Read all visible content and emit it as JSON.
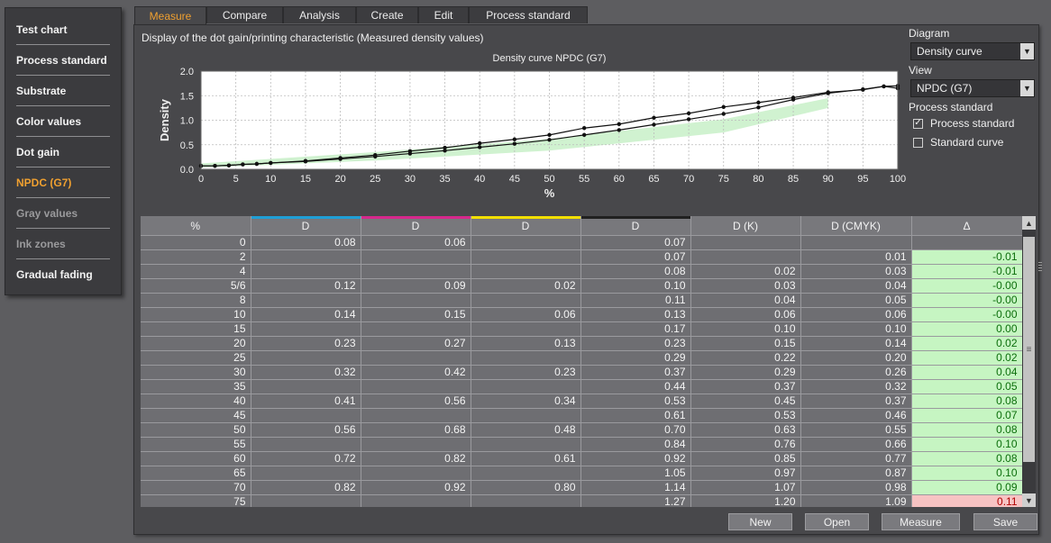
{
  "sidebar": {
    "items": [
      {
        "label": "Test chart",
        "state": "normal"
      },
      {
        "label": "Process standard",
        "state": "normal"
      },
      {
        "label": "Substrate",
        "state": "normal"
      },
      {
        "label": "Color values",
        "state": "normal"
      },
      {
        "label": "Dot gain",
        "state": "normal"
      },
      {
        "label": "NPDC (G7)",
        "state": "active"
      },
      {
        "label": "Gray values",
        "state": "dim"
      },
      {
        "label": "Ink zones",
        "state": "dim"
      },
      {
        "label": "Gradual fading",
        "state": "normal"
      }
    ]
  },
  "tabs": [
    "Measure",
    "Compare",
    "Analysis",
    "Create",
    "Edit",
    "Process standard"
  ],
  "active_tab": "Measure",
  "description": "Display of the dot gain/printing characteristic (Measured density values)",
  "controls": {
    "diagram_label": "Diagram",
    "diagram_value": "Density curve",
    "view_label": "View",
    "view_value": "NPDC (G7)",
    "process_standard_label": "Process standard",
    "checkbox_process_standard": {
      "label": "Process standard",
      "checked": true,
      "mark": "✓"
    },
    "checkbox_standard_curve": {
      "label": "Standard curve",
      "checked": false,
      "mark": ""
    }
  },
  "chart_data": {
    "type": "line",
    "title": "Density curve NPDC (G7)",
    "xlabel": "%",
    "ylabel": "Density",
    "xlim": [
      0,
      100
    ],
    "ylim": [
      0,
      2.0
    ],
    "x_ticks": [
      0,
      5,
      10,
      15,
      20,
      25,
      30,
      35,
      40,
      45,
      50,
      55,
      60,
      65,
      70,
      75,
      80,
      85,
      90,
      95,
      100
    ],
    "y_ticks": [
      0.0,
      0.5,
      1.0,
      1.5,
      2.0
    ],
    "y_tick_labels": [
      "0.0",
      "0.5",
      "1.0",
      "1.5",
      "2.0"
    ],
    "grid": true,
    "series": [
      {
        "values": [
          [
            0,
            0.07
          ],
          [
            2,
            0.07
          ],
          [
            4,
            0.08
          ],
          [
            6,
            0.1
          ],
          [
            8,
            0.11
          ],
          [
            10,
            0.13
          ],
          [
            15,
            0.17
          ],
          [
            20,
            0.23
          ],
          [
            25,
            0.29
          ],
          [
            30,
            0.37
          ],
          [
            35,
            0.44
          ],
          [
            40,
            0.53
          ],
          [
            45,
            0.61
          ],
          [
            50,
            0.7
          ],
          [
            55,
            0.84
          ],
          [
            60,
            0.92
          ],
          [
            65,
            1.05
          ],
          [
            70,
            1.14
          ],
          [
            75,
            1.27
          ],
          [
            80,
            1.36
          ],
          [
            85,
            1.46
          ],
          [
            90,
            1.57
          ],
          [
            95,
            1.62
          ],
          [
            98,
            1.69
          ],
          [
            100,
            1.7
          ]
        ]
      },
      {
        "values": [
          [
            0,
            0.07
          ],
          [
            2,
            0.07
          ],
          [
            4,
            0.08
          ],
          [
            6,
            0.1
          ],
          [
            8,
            0.11
          ],
          [
            10,
            0.13
          ],
          [
            15,
            0.16
          ],
          [
            20,
            0.21
          ],
          [
            25,
            0.26
          ],
          [
            30,
            0.32
          ],
          [
            35,
            0.38
          ],
          [
            40,
            0.45
          ],
          [
            45,
            0.52
          ],
          [
            50,
            0.6
          ],
          [
            55,
            0.7
          ],
          [
            60,
            0.8
          ],
          [
            65,
            0.91
          ],
          [
            70,
            1.02
          ],
          [
            75,
            1.13
          ],
          [
            80,
            1.26
          ],
          [
            85,
            1.42
          ],
          [
            90,
            1.55
          ],
          [
            95,
            1.63
          ],
          [
            98,
            1.69
          ],
          [
            100,
            1.65
          ]
        ]
      }
    ],
    "tolerance_band": {
      "lower": [
        [
          0,
          0.03
        ],
        [
          25,
          0.18
        ],
        [
          50,
          0.38
        ],
        [
          75,
          0.75
        ],
        [
          90,
          1.25
        ]
      ],
      "upper": [
        [
          0,
          0.12
        ],
        [
          25,
          0.35
        ],
        [
          50,
          0.62
        ],
        [
          75,
          1.02
        ],
        [
          90,
          1.45
        ]
      ],
      "color": "#c8f0c8"
    },
    "colors": {
      "series": "#111111",
      "band": "#c8f0c8",
      "background": "#ffffff",
      "grid": "#bbbbbb"
    }
  },
  "table": {
    "headers": [
      "%",
      "D",
      "D",
      "D",
      "D",
      "D (K)",
      "D (CMYK)",
      "Δ"
    ],
    "header_bar_colors": [
      "",
      "#1f9fd6",
      "#d6288c",
      "#f2e000",
      "#202020",
      "",
      "",
      ""
    ],
    "rows": [
      [
        "0",
        "0.08",
        "0.06",
        "",
        "0.07",
        "",
        "",
        ""
      ],
      [
        "2",
        "",
        "",
        "",
        "0.07",
        "",
        "0.01",
        "-0.01"
      ],
      [
        "4",
        "",
        "",
        "",
        "0.08",
        "0.02",
        "0.03",
        "-0.01"
      ],
      [
        "5/6",
        "0.12",
        "0.09",
        "0.02",
        "0.10",
        "0.03",
        "0.04",
        "-0.00"
      ],
      [
        "8",
        "",
        "",
        "",
        "0.11",
        "0.04",
        "0.05",
        "-0.00"
      ],
      [
        "10",
        "0.14",
        "0.15",
        "0.06",
        "0.13",
        "0.06",
        "0.06",
        "-0.00"
      ],
      [
        "15",
        "",
        "",
        "",
        "0.17",
        "0.10",
        "0.10",
        "0.00"
      ],
      [
        "20",
        "0.23",
        "0.27",
        "0.13",
        "0.23",
        "0.15",
        "0.14",
        "0.02"
      ],
      [
        "25",
        "",
        "",
        "",
        "0.29",
        "0.22",
        "0.20",
        "0.02"
      ],
      [
        "30",
        "0.32",
        "0.42",
        "0.23",
        "0.37",
        "0.29",
        "0.26",
        "0.04"
      ],
      [
        "35",
        "",
        "",
        "",
        "0.44",
        "0.37",
        "0.32",
        "0.05"
      ],
      [
        "40",
        "0.41",
        "0.56",
        "0.34",
        "0.53",
        "0.45",
        "0.37",
        "0.08"
      ],
      [
        "45",
        "",
        "",
        "",
        "0.61",
        "0.53",
        "0.46",
        "0.07"
      ],
      [
        "50",
        "0.56",
        "0.68",
        "0.48",
        "0.70",
        "0.63",
        "0.55",
        "0.08"
      ],
      [
        "55",
        "",
        "",
        "",
        "0.84",
        "0.76",
        "0.66",
        "0.10"
      ],
      [
        "60",
        "0.72",
        "0.82",
        "0.61",
        "0.92",
        "0.85",
        "0.77",
        "0.08"
      ],
      [
        "65",
        "",
        "",
        "",
        "1.05",
        "0.97",
        "0.87",
        "0.10"
      ],
      [
        "70",
        "0.82",
        "0.92",
        "0.80",
        "1.14",
        "1.07",
        "0.98",
        "0.09"
      ],
      [
        "75",
        "",
        "",
        "",
        "1.27",
        "1.20",
        "1.09",
        "0.11"
      ]
    ],
    "delta_status": [
      "none",
      "ok",
      "ok",
      "ok",
      "ok",
      "ok",
      "ok",
      "ok",
      "ok",
      "ok",
      "ok",
      "ok",
      "ok",
      "ok",
      "ok",
      "ok",
      "ok",
      "ok",
      "bad"
    ],
    "status_colors": {
      "ok": "#c6f5c2",
      "bad": "#f7c3c3"
    }
  },
  "scrollbar": {
    "up_icon": "▲",
    "down_icon": "▼",
    "grip_icon": "≡"
  },
  "buttons": {
    "new": "New",
    "open": "Open",
    "measure": "Measure",
    "save": "Save"
  }
}
